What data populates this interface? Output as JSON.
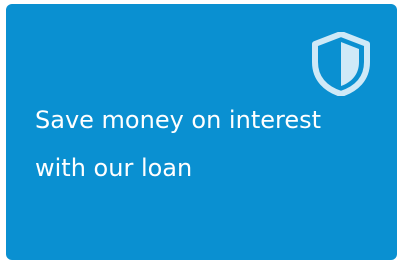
{
  "card": {
    "text": "Save money on interest with our loan",
    "background_color": "#0a90d1",
    "icon": "shield-icon",
    "icon_color": "#cfe9f7"
  }
}
